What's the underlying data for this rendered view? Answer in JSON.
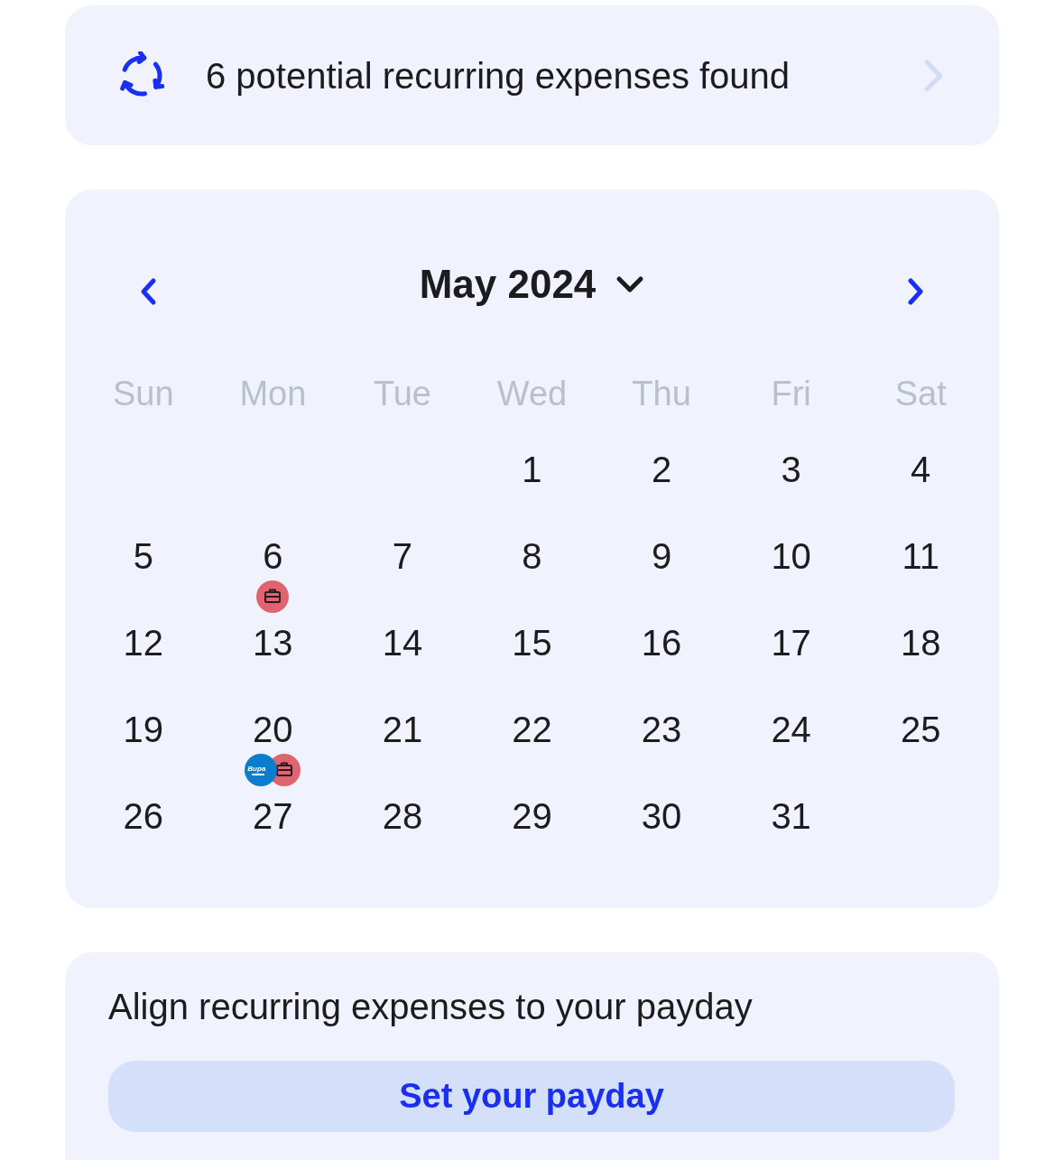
{
  "banner": {
    "text": "6 potential recurring expenses found"
  },
  "calendar": {
    "month_label": "May 2024",
    "weekdays": [
      "Sun",
      "Mon",
      "Tue",
      "Wed",
      "Thu",
      "Fri",
      "Sat"
    ],
    "weeks": [
      {
        "days": [
          {
            "kind": "blank"
          },
          {
            "kind": "blank"
          },
          {
            "kind": "blank"
          },
          {
            "kind": "day",
            "label": "1"
          },
          {
            "kind": "day",
            "label": "2"
          },
          {
            "kind": "day",
            "label": "3"
          },
          {
            "kind": "day",
            "label": "4"
          }
        ]
      },
      {
        "days": [
          {
            "kind": "day",
            "label": "5"
          },
          {
            "kind": "day",
            "label": "6",
            "markers": [
              {
                "kind": "briefcase",
                "color": "#e0646f"
              }
            ]
          },
          {
            "kind": "day",
            "label": "7"
          },
          {
            "kind": "day",
            "label": "8"
          },
          {
            "kind": "day",
            "label": "9"
          },
          {
            "kind": "day",
            "label": "10"
          },
          {
            "kind": "day",
            "label": "11"
          }
        ]
      },
      {
        "days": [
          {
            "kind": "day",
            "label": "12"
          },
          {
            "kind": "day",
            "label": "13"
          },
          {
            "kind": "day",
            "label": "14"
          },
          {
            "kind": "day",
            "label": "15"
          },
          {
            "kind": "day",
            "label": "16"
          },
          {
            "kind": "day",
            "label": "17"
          },
          {
            "kind": "day",
            "label": "18"
          }
        ]
      },
      {
        "days": [
          {
            "kind": "day",
            "label": "19"
          },
          {
            "kind": "day",
            "label": "20",
            "markers": [
              {
                "kind": "logo",
                "label": "Bupa",
                "color": "#0a7dcc"
              },
              {
                "kind": "briefcase",
                "color": "#e0646f"
              }
            ]
          },
          {
            "kind": "day",
            "label": "21"
          },
          {
            "kind": "day",
            "label": "22"
          },
          {
            "kind": "day",
            "label": "23"
          },
          {
            "kind": "day",
            "label": "24"
          },
          {
            "kind": "day",
            "label": "25"
          }
        ]
      },
      {
        "days": [
          {
            "kind": "day",
            "label": "26"
          },
          {
            "kind": "day",
            "label": "27"
          },
          {
            "kind": "day",
            "label": "28"
          },
          {
            "kind": "day",
            "label": "29"
          },
          {
            "kind": "day",
            "label": "30"
          },
          {
            "kind": "day",
            "label": "31"
          },
          {
            "kind": "blank"
          }
        ]
      }
    ]
  },
  "payday": {
    "text": "Align recurring expenses to your payday",
    "button": "Set your payday"
  }
}
